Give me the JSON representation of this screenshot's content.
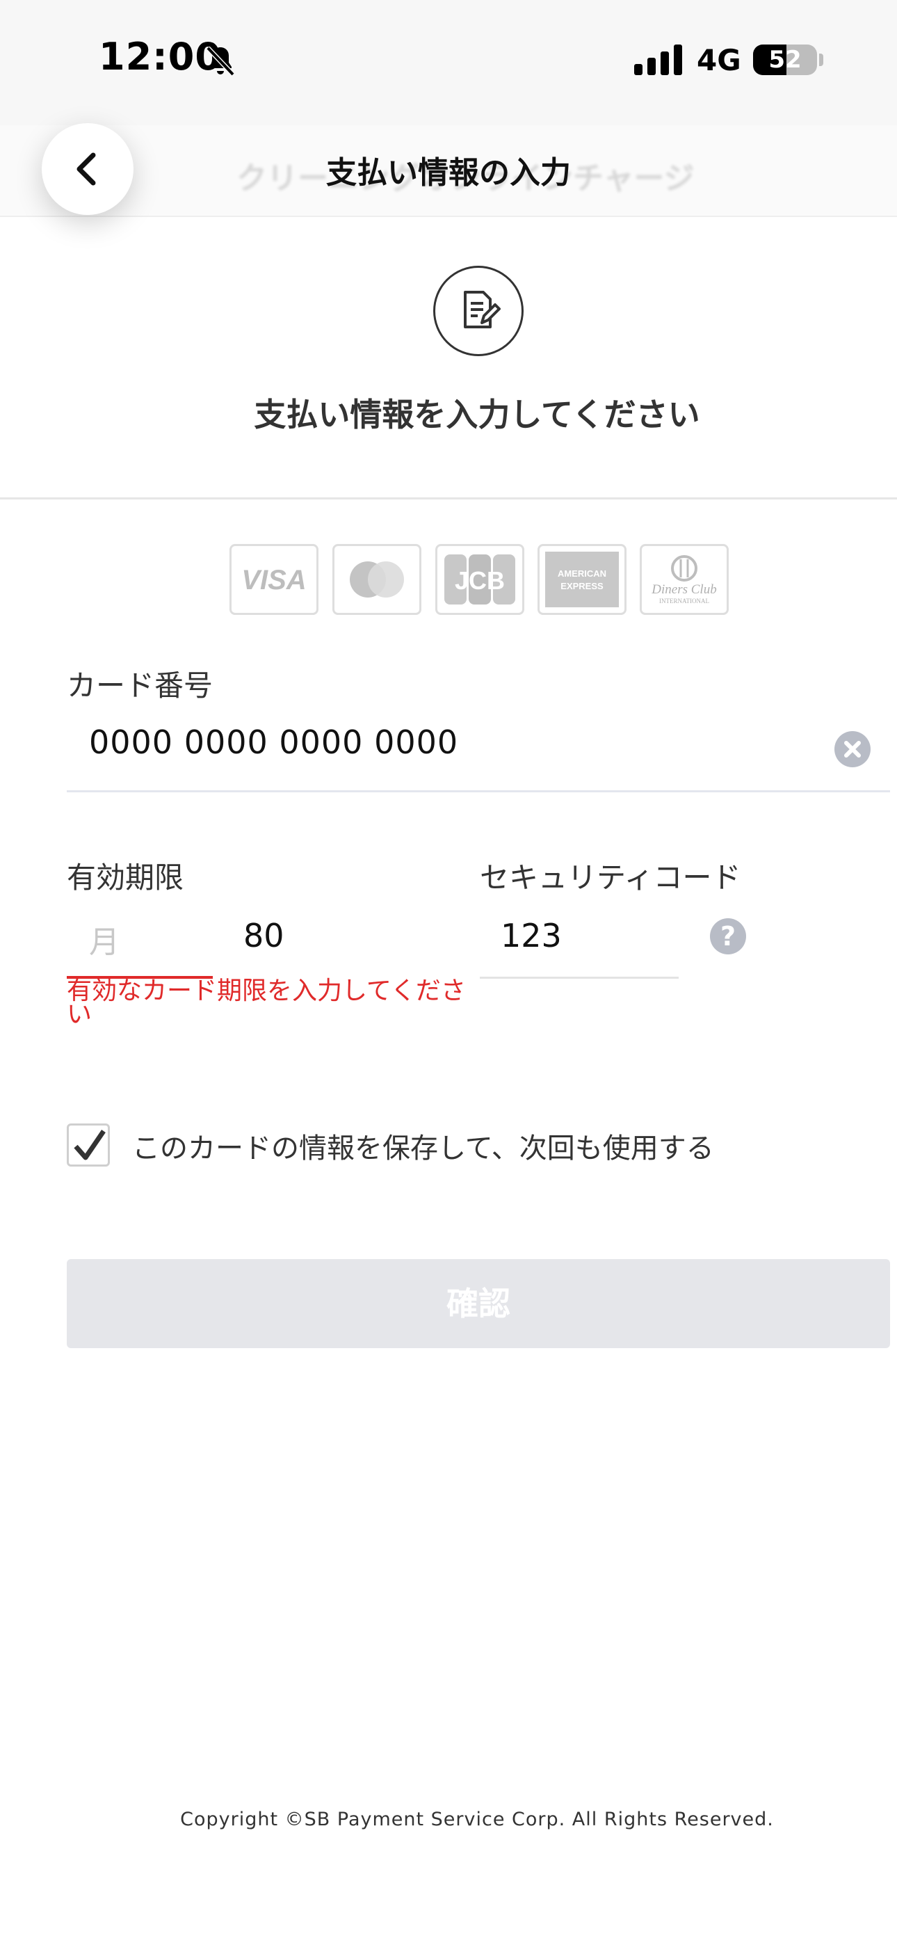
{
  "status_bar": {
    "time": "12:00",
    "network": "4G",
    "battery_level": "52",
    "battery_fraction": 0.52,
    "icons": [
      "bell-slash-icon",
      "signal-icon",
      "battery-icon"
    ]
  },
  "header": {
    "title": "支払い情報の入力",
    "background_title": "クリーニングオンラインチャージ",
    "back_icon": "chevron-left-icon"
  },
  "intro": {
    "icon": "document-edit-icon",
    "heading": "支払い情報を入力してください"
  },
  "card_brands": [
    {
      "name": "VISA",
      "icon": "visa-logo-icon"
    },
    {
      "name": "Mastercard",
      "icon": "mastercard-logo-icon"
    },
    {
      "name": "JCB",
      "icon": "jcb-logo-icon"
    },
    {
      "name": "AMERICAN EXPRESS",
      "icon": "amex-logo-icon"
    },
    {
      "name": "Diners Club INTERNATIONAL",
      "icon": "diners-club-logo-icon"
    }
  ],
  "card_number": {
    "label": "カード番号",
    "value": "0000 0000 0000 0000",
    "clear_icon": "clear-circle-icon"
  },
  "expiry": {
    "label": "有効期限",
    "month_placeholder": "月",
    "year_value": "80",
    "error": "有効なカード期限を入力してください"
  },
  "security_code": {
    "label": "セキュリティコード",
    "value": "123",
    "help_icon": "question-circle-icon",
    "help_glyph": "?"
  },
  "save_card": {
    "checked": true,
    "label": "このカードの情報を保存して、次回も使用する"
  },
  "confirm_button": {
    "label": "確認",
    "enabled": false
  },
  "footer": {
    "copyright": "Copyright ©SB Payment Service Corp. All Rights Reserved."
  },
  "colors": {
    "error": "#e02a2a",
    "button_disabled": "#e5e6ea",
    "text": "#333333"
  }
}
